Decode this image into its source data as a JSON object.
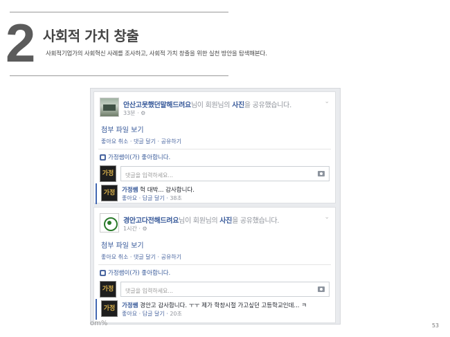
{
  "section": {
    "number": "2",
    "title": "사회적 가치 창출",
    "subtitle": "사회적기업가의 사회혁신 사례를 조사하고, 사회적 가치 창출을 위한 실천 방안을 탐색해본다."
  },
  "posts": [
    {
      "author": "안산고못했던말해드려요",
      "mid": "님이 회원님의 ",
      "object": "사진",
      "end": "을 공유했습니다.",
      "time": "33분 · ",
      "globe_icon": "⚙",
      "attachment": "첨부 파일 보기",
      "actions": "좋아요 취소 · 댓글 달기 · 공유하기",
      "likes": "가정쌤이(가) 좋아합니다.",
      "comment_placeholder": "댓글을 입력하세요...",
      "reply": {
        "avatar_text": "가정",
        "name": "가정쌤",
        "text": " 헉 대박... 감사합니다.",
        "actions": "좋아요 · 답글 달기 · ",
        "time": "38초"
      }
    },
    {
      "author": "경안고다전해드려요",
      "mid": "님이 회원님의 ",
      "object": "사진",
      "end": "을 공유했습니다.",
      "time": "1시간 · ",
      "globe_icon": "⚙",
      "attachment": "첨부 파일 보기",
      "actions": "좋아요 취소 · 댓글 달기 · 공유하기",
      "likes": "가정쌤이(가) 좋아합니다.",
      "comment_placeholder": "댓글을 입력하세요...",
      "reply": {
        "avatar_text": "가정",
        "name": "가정쌤",
        "text": " 경안고 감사합니다. ㅜㅜ 제가 학창시절 가고싶던 고등학교인데... ㅋ",
        "actions": "좋아요 · 답글 달기 · ",
        "time": "20초"
      }
    }
  ],
  "chevron": "⌄",
  "bleed_text": "om%",
  "page_number": "53",
  "colors": {
    "fb_blue": "#365899",
    "frame_bg": "#e9ebee",
    "heading_gray": "#5b5b5b"
  }
}
